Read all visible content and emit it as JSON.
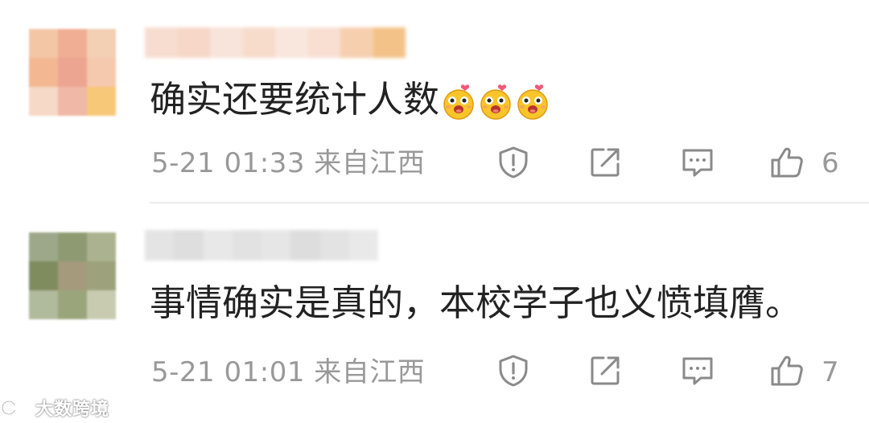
{
  "comments": [
    {
      "text": "确实还要统计人数",
      "emoji_count": 3,
      "meta": "5-21 01:33 来自江西",
      "likes": "6",
      "avatar_colors": [
        "#f3c6a6",
        "#f0ae94",
        "#f3cfb4",
        "#f3b892",
        "#eba590",
        "#f4c9ad",
        "#f6d9c7",
        "#f0b9a7",
        "#f7c878"
      ],
      "name_colors": [
        "#f7ddd0",
        "#f6d7c8",
        "#f8e4da",
        "#f7dccb",
        "#f9e6dc",
        "#f8dfd2",
        "#f6cfae",
        "#f3c288"
      ]
    },
    {
      "text": "事情确实是真的，本校学子也义愤填膺。",
      "emoji_count": 0,
      "meta": "5-21 01:01 来自江西",
      "likes": "7",
      "avatar_colors": [
        "#9da88a",
        "#8d9a72",
        "#aab28f",
        "#7f8c5e",
        "#a49a7c",
        "#9ea27c",
        "#b0ba9c",
        "#9aa57c",
        "#c8cbb0"
      ],
      "name_colors": [
        "#e4e4e4",
        "#dedede",
        "#e8e8e8",
        "#e2e2e2",
        "#e6e6e6",
        "#dddddd",
        "#e3e3e3",
        "#e9e9e9"
      ]
    }
  ],
  "icons": {
    "report": "shield-exclamation-icon",
    "forward": "share-icon",
    "comment": "comment-bubble-icon",
    "like": "thumbs-up-icon"
  },
  "watermark": {
    "text": "大数跨境"
  },
  "colors": {
    "text": "#222222",
    "meta": "#999999",
    "icon": "#8a8a8a",
    "divider": "#ececec"
  }
}
